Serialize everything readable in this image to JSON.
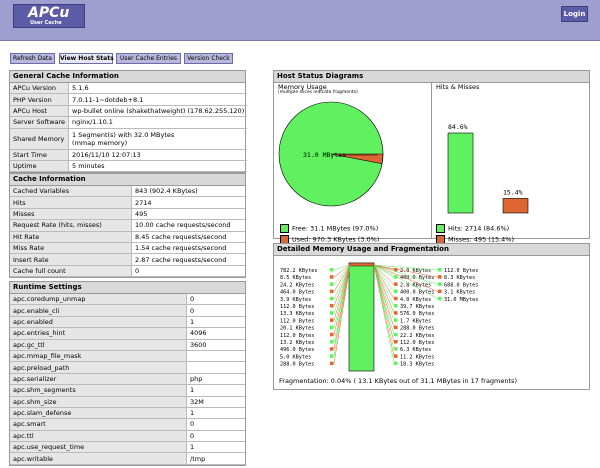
{
  "app": {
    "logo_title": "APCu",
    "logo_subtitle": "User Cache",
    "login_label": "Login"
  },
  "nav": [
    "Refresh Data",
    "View Host Stats",
    "User Cache Entries",
    "Version Check"
  ],
  "general": {
    "title": "General Cache Information",
    "rows": [
      [
        "APCu Version",
        "5.1.6"
      ],
      [
        "PHP Version",
        "7.0.11-1~dotdeb+8.1"
      ],
      [
        "APCu Host",
        "wp-bullet online (shakethatweight) (178.62.255.120)"
      ],
      [
        "Server Software",
        "nginx/1.10.1"
      ],
      [
        "Shared Memory",
        "1 Segment(s) with 32.0 MBytes\n(mmap memory)"
      ],
      [
        "Start Time",
        "2016/11/10 12:07:13"
      ],
      [
        "Uptime",
        "5 minutes"
      ]
    ]
  },
  "cache": {
    "title": "Cache Information",
    "rows": [
      [
        "Cached Variables",
        "843 (902.4 KBytes)"
      ],
      [
        "Hits",
        "2714"
      ],
      [
        "Misses",
        "495"
      ],
      [
        "Request Rate (hits, misses)",
        "10.00 cache requests/second"
      ],
      [
        "Hit Rate",
        "8.45 cache requests/second"
      ],
      [
        "Miss Rate",
        "1.54 cache requests/second"
      ],
      [
        "Insert Rate",
        "2.87 cache requests/second"
      ],
      [
        "Cache full count",
        "0"
      ]
    ]
  },
  "runtime": {
    "title": "Runtime Settings",
    "rows": [
      [
        "apc.coredump_unmap",
        "0"
      ],
      [
        "apc.enable_cli",
        "0"
      ],
      [
        "apc.enabled",
        "1"
      ],
      [
        "apc.entries_hint",
        "4096"
      ],
      [
        "apc.gc_ttl",
        "3600"
      ],
      [
        "apc.mmap_file_mask",
        ""
      ],
      [
        "apc.preload_path",
        ""
      ],
      [
        "apc.serializer",
        "php"
      ],
      [
        "apc.shm_segments",
        "1"
      ],
      [
        "apc.shm_size",
        "32M"
      ],
      [
        "apc.slam_defense",
        "1"
      ],
      [
        "apc.smart",
        "0"
      ],
      [
        "apc.ttl",
        "0"
      ],
      [
        "apc.use_request_time",
        "1"
      ],
      [
        "apc.writable",
        "/tmp"
      ]
    ]
  },
  "host_diagrams": {
    "title": "Host Status Diagrams",
    "memory_title": "Memory Usage",
    "memory_note": "(multiple slices indicate fragments)",
    "hits_title": "Hits & Misses",
    "pie_label": "31.0 MBytes",
    "free_label": "Free: 31.1 MBytes (97.0%)",
    "used_label": "Used: 970.3 KBytes (3.0%)",
    "hits_label": "Hits: 2714 (84.6%)",
    "misses_label": "Misses: 495 (15.4%)",
    "free_color": "#60f060",
    "used_color": "#dd6633"
  },
  "chart_data": {
    "type": "bar",
    "categories": [
      "Hits",
      "Misses"
    ],
    "values": [
      84.6,
      15.4
    ],
    "data_labels": [
      "84.6%",
      "15.4%"
    ],
    "pie": {
      "type": "pie",
      "slices": [
        {
          "label": "Free",
          "value": 97.0
        },
        {
          "label": "Used",
          "value": 3.0
        }
      ]
    }
  },
  "detailed": {
    "title": "Detailed Memory Usage and Fragmentation",
    "left_labels": [
      "782.2 KBytes",
      "8.5 KBytes",
      "24.2 KBytes",
      "464.0 Bytes",
      "3.9 KBytes",
      "112.0 Bytes",
      "13.3 KBytes",
      "112.0 Bytes",
      "20.1 KBytes",
      "112.0 Bytes",
      "13.2 KBytes",
      "496.0 Bytes",
      "5.0 KBytes",
      "288.0 Bytes"
    ],
    "mid_labels": [
      "2.0 KBytes",
      "400.0 Bytes",
      "2.8 KBytes",
      "400.0 Bytes",
      "4.0 KBytes",
      "39.7 KBytes",
      "576.0 Bytes",
      "1.7 KBytes",
      "288.0 Bytes",
      "22.2 KBytes",
      "112.0 Bytes",
      "6.3 KBytes",
      "11.2 KBytes",
      "18.3 KBytes"
    ],
    "right_labels": [
      "112.0 Bytes",
      "8.3 KBytes",
      "688.0 Bytes",
      "3.1 KBytes",
      "31.0 MBytes"
    ],
    "fragmentation": "Fragmentation: 0.04% ( 13.1 KBytes out of 31.1 MBytes in 17 fragments)"
  }
}
